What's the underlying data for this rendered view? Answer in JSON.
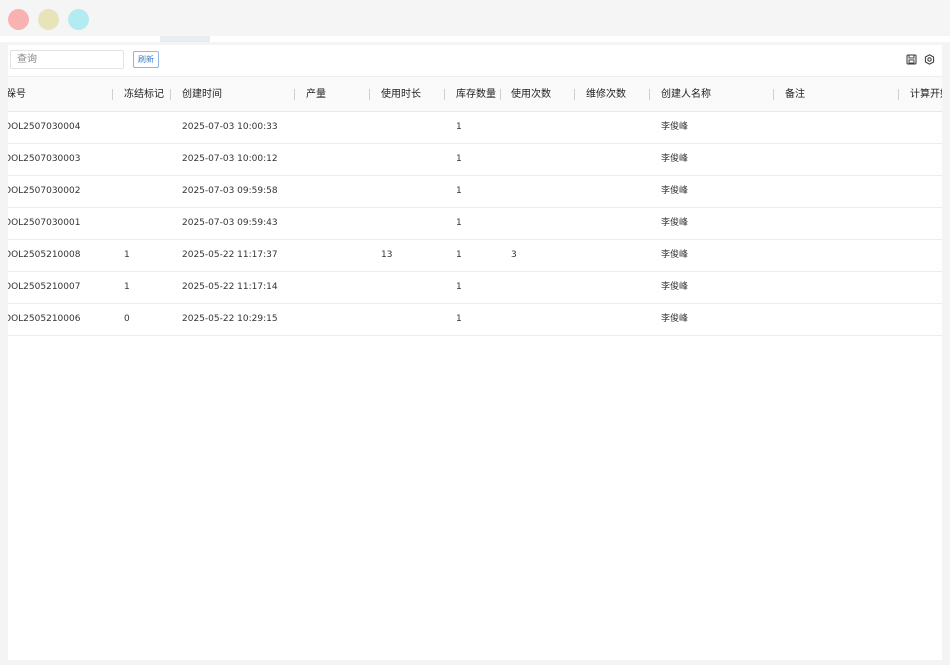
{
  "window": {
    "traffic_lights": [
      "close",
      "minimize",
      "maximize"
    ],
    "colors": {
      "close": "#f8b2b2",
      "minimize": "#e6e4b8",
      "maximize": "#b3ecf0"
    }
  },
  "toolbar": {
    "search_placeholder": "查询",
    "refresh_label": "刷新",
    "icons": [
      "save-icon",
      "settings-icon"
    ]
  },
  "columns": [
    {
      "key": "no",
      "label": "跺号"
    },
    {
      "key": "freeze",
      "label": "冻结标记"
    },
    {
      "key": "ctime",
      "label": "创建时间"
    },
    {
      "key": "output",
      "label": "产量"
    },
    {
      "key": "usetime",
      "label": "使用时长"
    },
    {
      "key": "stock",
      "label": "库存数量"
    },
    {
      "key": "usecount",
      "label": "使用次数"
    },
    {
      "key": "repair",
      "label": "维修次数"
    },
    {
      "key": "creator",
      "label": "创建人名称"
    },
    {
      "key": "remark",
      "label": "备注"
    },
    {
      "key": "calc",
      "label": "计算开始"
    }
  ],
  "rows": [
    {
      "no": "OOL2507030004",
      "freeze": "",
      "ctime": "2025-07-03 10:00:33",
      "output": "",
      "usetime": "",
      "stock": "1",
      "usecount": "",
      "repair": "",
      "creator": "李俊峰",
      "remark": "",
      "calc": ""
    },
    {
      "no": "OOL2507030003",
      "freeze": "",
      "ctime": "2025-07-03 10:00:12",
      "output": "",
      "usetime": "",
      "stock": "1",
      "usecount": "",
      "repair": "",
      "creator": "李俊峰",
      "remark": "",
      "calc": ""
    },
    {
      "no": "OOL2507030002",
      "freeze": "",
      "ctime": "2025-07-03 09:59:58",
      "output": "",
      "usetime": "",
      "stock": "1",
      "usecount": "",
      "repair": "",
      "creator": "李俊峰",
      "remark": "",
      "calc": ""
    },
    {
      "no": "OOL2507030001",
      "freeze": "",
      "ctime": "2025-07-03 09:59:43",
      "output": "",
      "usetime": "",
      "stock": "1",
      "usecount": "",
      "repair": "",
      "creator": "李俊峰",
      "remark": "",
      "calc": ""
    },
    {
      "no": "OOL2505210008",
      "freeze": "1",
      "ctime": "2025-05-22 11:17:37",
      "output": "",
      "usetime": "13",
      "stock": "1",
      "usecount": "3",
      "repair": "",
      "creator": "李俊峰",
      "remark": "",
      "calc": ""
    },
    {
      "no": "OOL2505210007",
      "freeze": "1",
      "ctime": "2025-05-22 11:17:14",
      "output": "",
      "usetime": "",
      "stock": "1",
      "usecount": "",
      "repair": "",
      "creator": "李俊峰",
      "remark": "",
      "calc": ""
    },
    {
      "no": "OOL2505210006",
      "freeze": "0",
      "ctime": "2025-05-22 10:29:15",
      "output": "",
      "usetime": "",
      "stock": "1",
      "usecount": "",
      "repair": "",
      "creator": "李俊峰",
      "remark": "",
      "calc": ""
    }
  ]
}
